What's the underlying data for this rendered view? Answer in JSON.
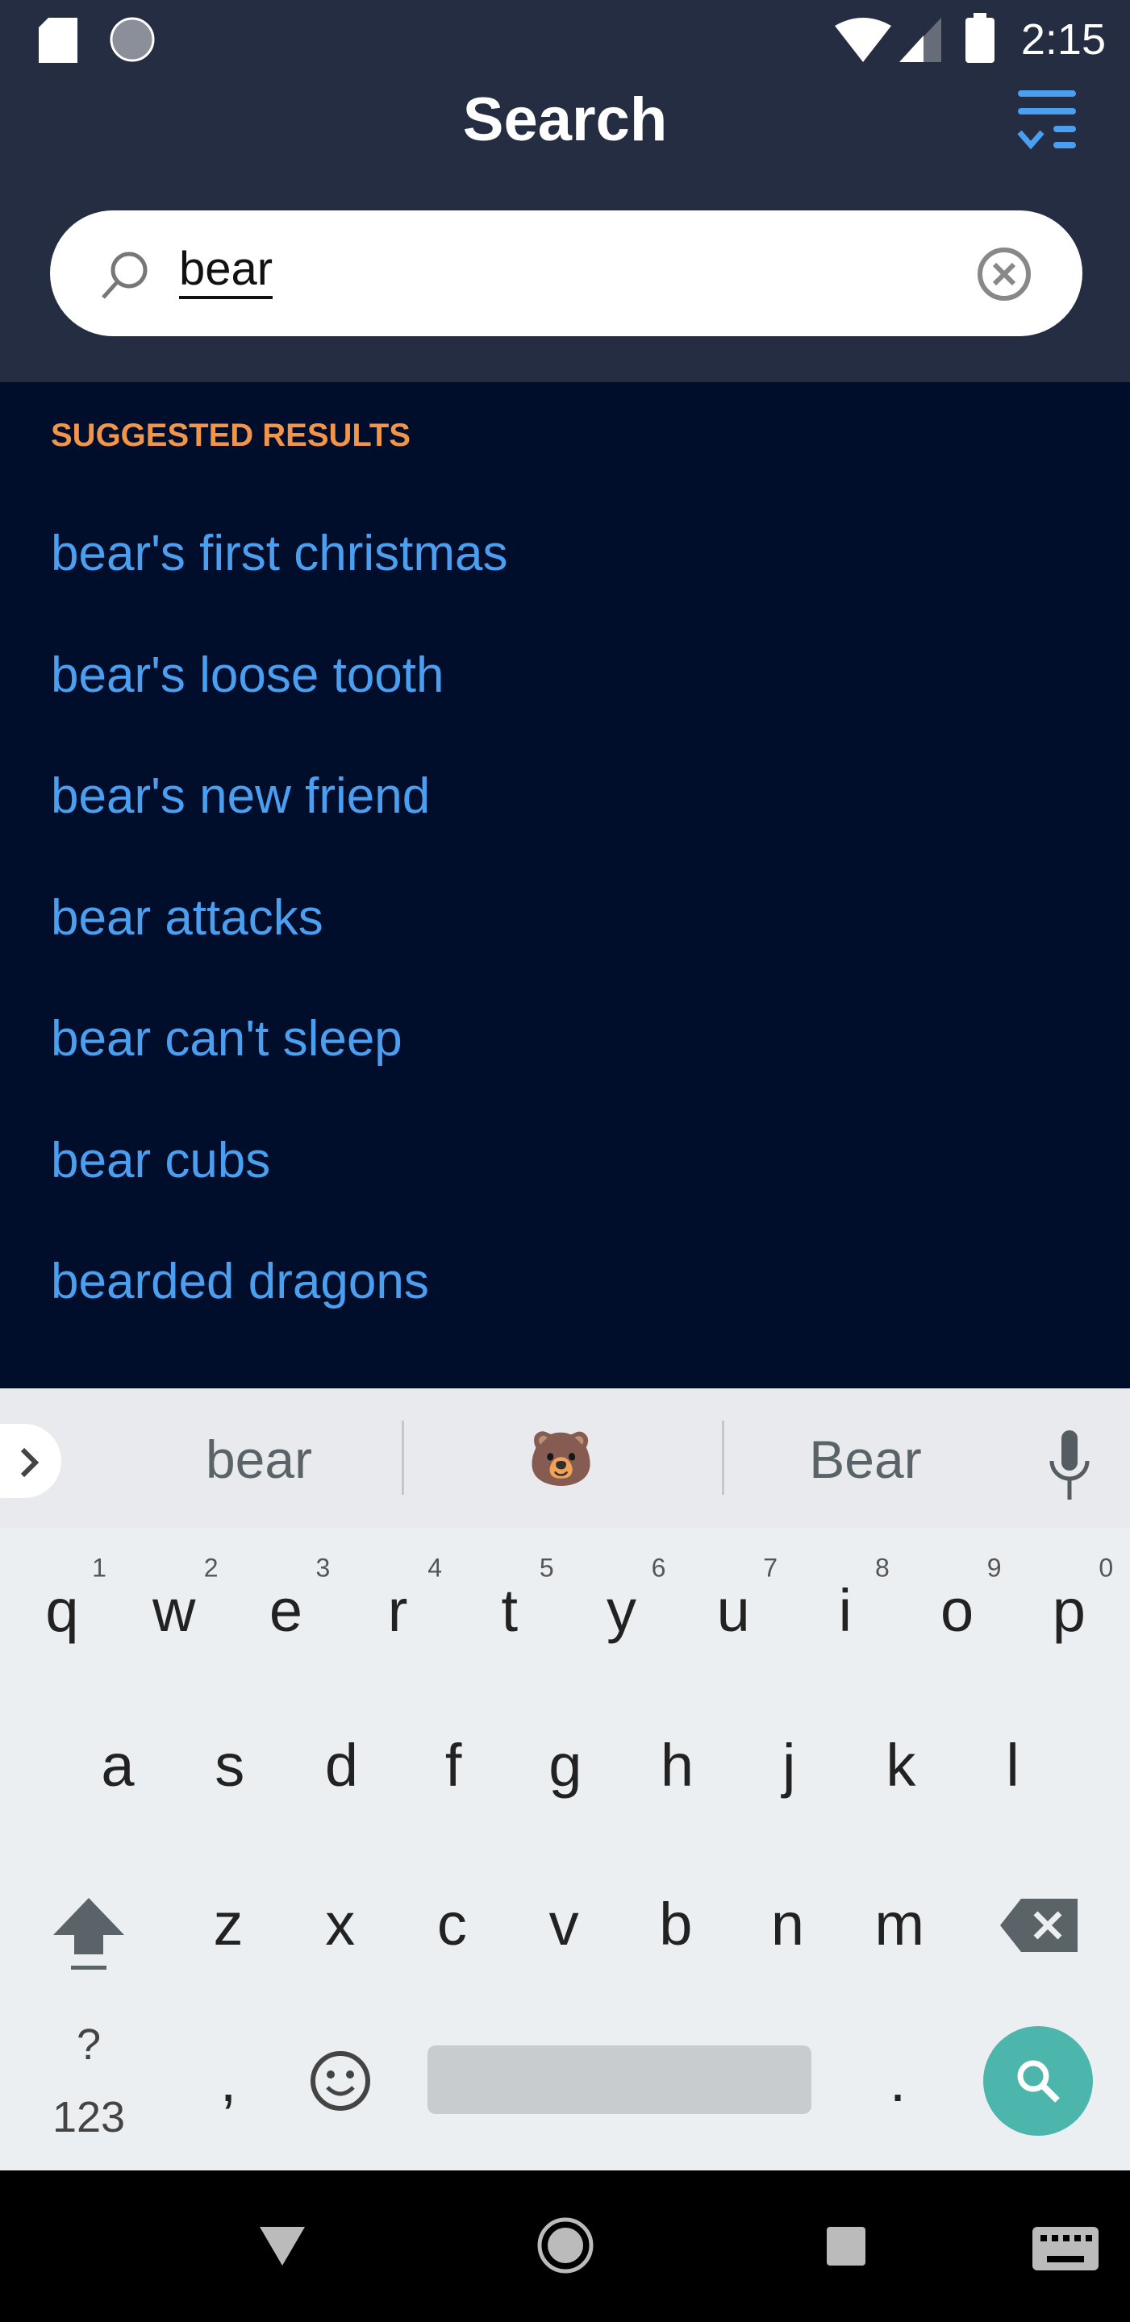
{
  "status_bar": {
    "time": "2:15",
    "icons": [
      "sd-card-icon",
      "sync-icon",
      "wifi-icon",
      "signal-icon",
      "battery-icon"
    ]
  },
  "header": {
    "title": "Search",
    "filter_icon": "filter-list-icon"
  },
  "search": {
    "value": "bear",
    "icon": "search-icon",
    "clear_icon": "clear-circle-icon"
  },
  "suggestions": {
    "heading": "SUGGESTED RESULTS",
    "items": [
      "bear's first christmas",
      "bear's loose tooth",
      "bear's new friend",
      "bear attacks",
      "bear can't sleep",
      "bear cubs",
      "bearded dragons"
    ]
  },
  "keyboard": {
    "suggestions": [
      "bear",
      "🐻",
      "Bear"
    ],
    "row1": [
      "q",
      "w",
      "e",
      "r",
      "t",
      "y",
      "u",
      "i",
      "o",
      "p"
    ],
    "row1_hints": [
      "1",
      "2",
      "3",
      "4",
      "5",
      "6",
      "7",
      "8",
      "9",
      "0"
    ],
    "row2": [
      "a",
      "s",
      "d",
      "f",
      "g",
      "h",
      "j",
      "k",
      "l"
    ],
    "row3": [
      "z",
      "x",
      "c",
      "v",
      "b",
      "n",
      "m"
    ],
    "symbols": "?123",
    "comma": ",",
    "period": ".",
    "accent": "#4db6ac"
  },
  "colors": {
    "header": "#252d42",
    "background": "#000e2b",
    "heading": "#f0954a",
    "link": "#4a9ff0"
  }
}
